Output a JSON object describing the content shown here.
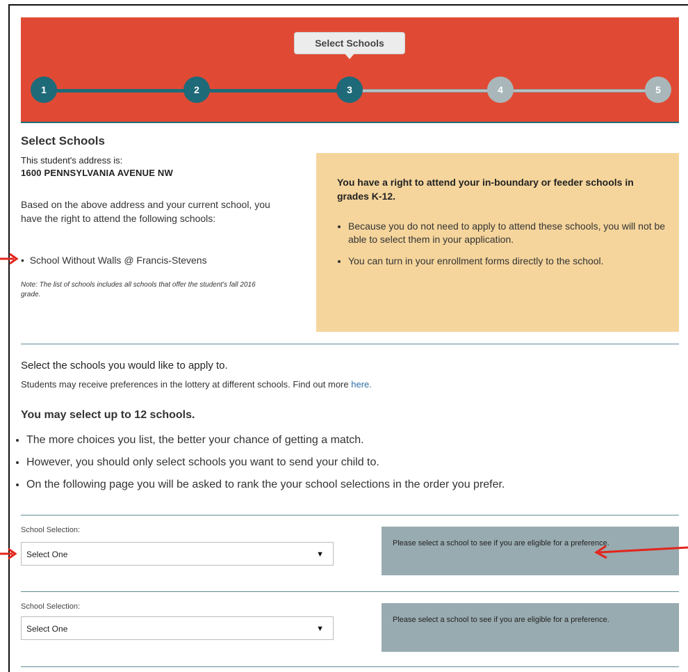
{
  "progress": {
    "tooltip": "Select Schools",
    "steps": [
      "1",
      "2",
      "3",
      "4",
      "5"
    ],
    "current_step": 3,
    "colors": {
      "header": "#e04a34",
      "done": "#1e6a79",
      "todo": "#a9b7ba"
    }
  },
  "select_schools": {
    "title": "Select Schools",
    "address_label": "This student's address is:",
    "address": "1600 PENNSYLVANIA AVENUE NW",
    "based_on": "Based on the above address and your current school, you have the right to attend the following schools:",
    "schools": [
      "School Without Walls @ Francis-Stevens"
    ],
    "note": "Note: The list of schools includes all schools that offer the student's fall 2016 grade."
  },
  "rights_box": {
    "title": "You have a right to attend your in-boundary or feeder schools in grades K-12.",
    "bullets": [
      "Because you do not need to apply to attend these schools, you will not be able to select them in your application.",
      "You can turn in your enrollment forms directly to the school."
    ],
    "color": "#f5d59c"
  },
  "apply": {
    "title": "Select the schools you would like to apply to.",
    "preferences_text": "Students may receive preferences in the lottery at different schools. Find out more ",
    "preferences_link": "here.",
    "limit_title": "You may select up to 12 schools.",
    "tips": [
      "The more choices you list, the better your chance of getting a match.",
      "However, you should only select schools you want to send your child to.",
      "On the following page you will be asked to rank the your school selections in the order you prefer."
    ]
  },
  "selections": [
    {
      "label": "School Selection:",
      "value": "Select One",
      "preference_message": "Please select a school to see if you are eligible for a preference."
    },
    {
      "label": "School Selection:",
      "value": "Select One",
      "preference_message": "Please select a school to see if you are eligible for a preference."
    }
  ],
  "annotation_color": "#e3241b"
}
